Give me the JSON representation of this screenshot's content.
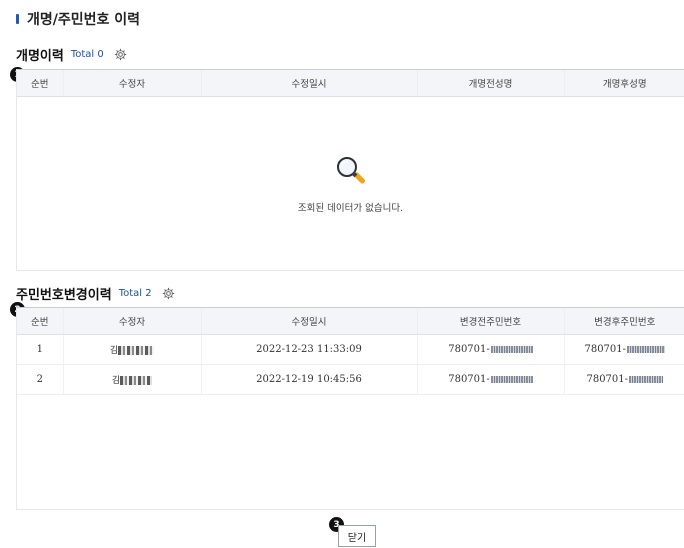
{
  "page": {
    "title": "개명/주민번호 이력"
  },
  "rename_section": {
    "title": "개명이력",
    "total": "Total 0",
    "badge": "1",
    "columns": [
      "순번",
      "수정자",
      "수정일시",
      "개명전성명",
      "개명후성명"
    ],
    "empty_message": "조회된 데이터가 없습니다."
  },
  "rrn_section": {
    "title": "주민번호변경이력",
    "total": "Total 2",
    "badge": "2",
    "columns": [
      "순번",
      "수정자",
      "수정일시",
      "변경전주민번호",
      "변경후주민번호"
    ],
    "rows": [
      {
        "no": "1",
        "editor_prefix": "김",
        "date": "2022-12-23 11:33:09",
        "before": "780701-",
        "after": "780701-"
      },
      {
        "no": "2",
        "editor_prefix": "김",
        "date": "2022-12-19 10:45:56",
        "before": "780701-",
        "after": "780701-"
      }
    ]
  },
  "footer": {
    "badge": "3",
    "close_label": "닫기"
  },
  "icons": {
    "gear": "gear-icon",
    "search": "search-icon"
  }
}
